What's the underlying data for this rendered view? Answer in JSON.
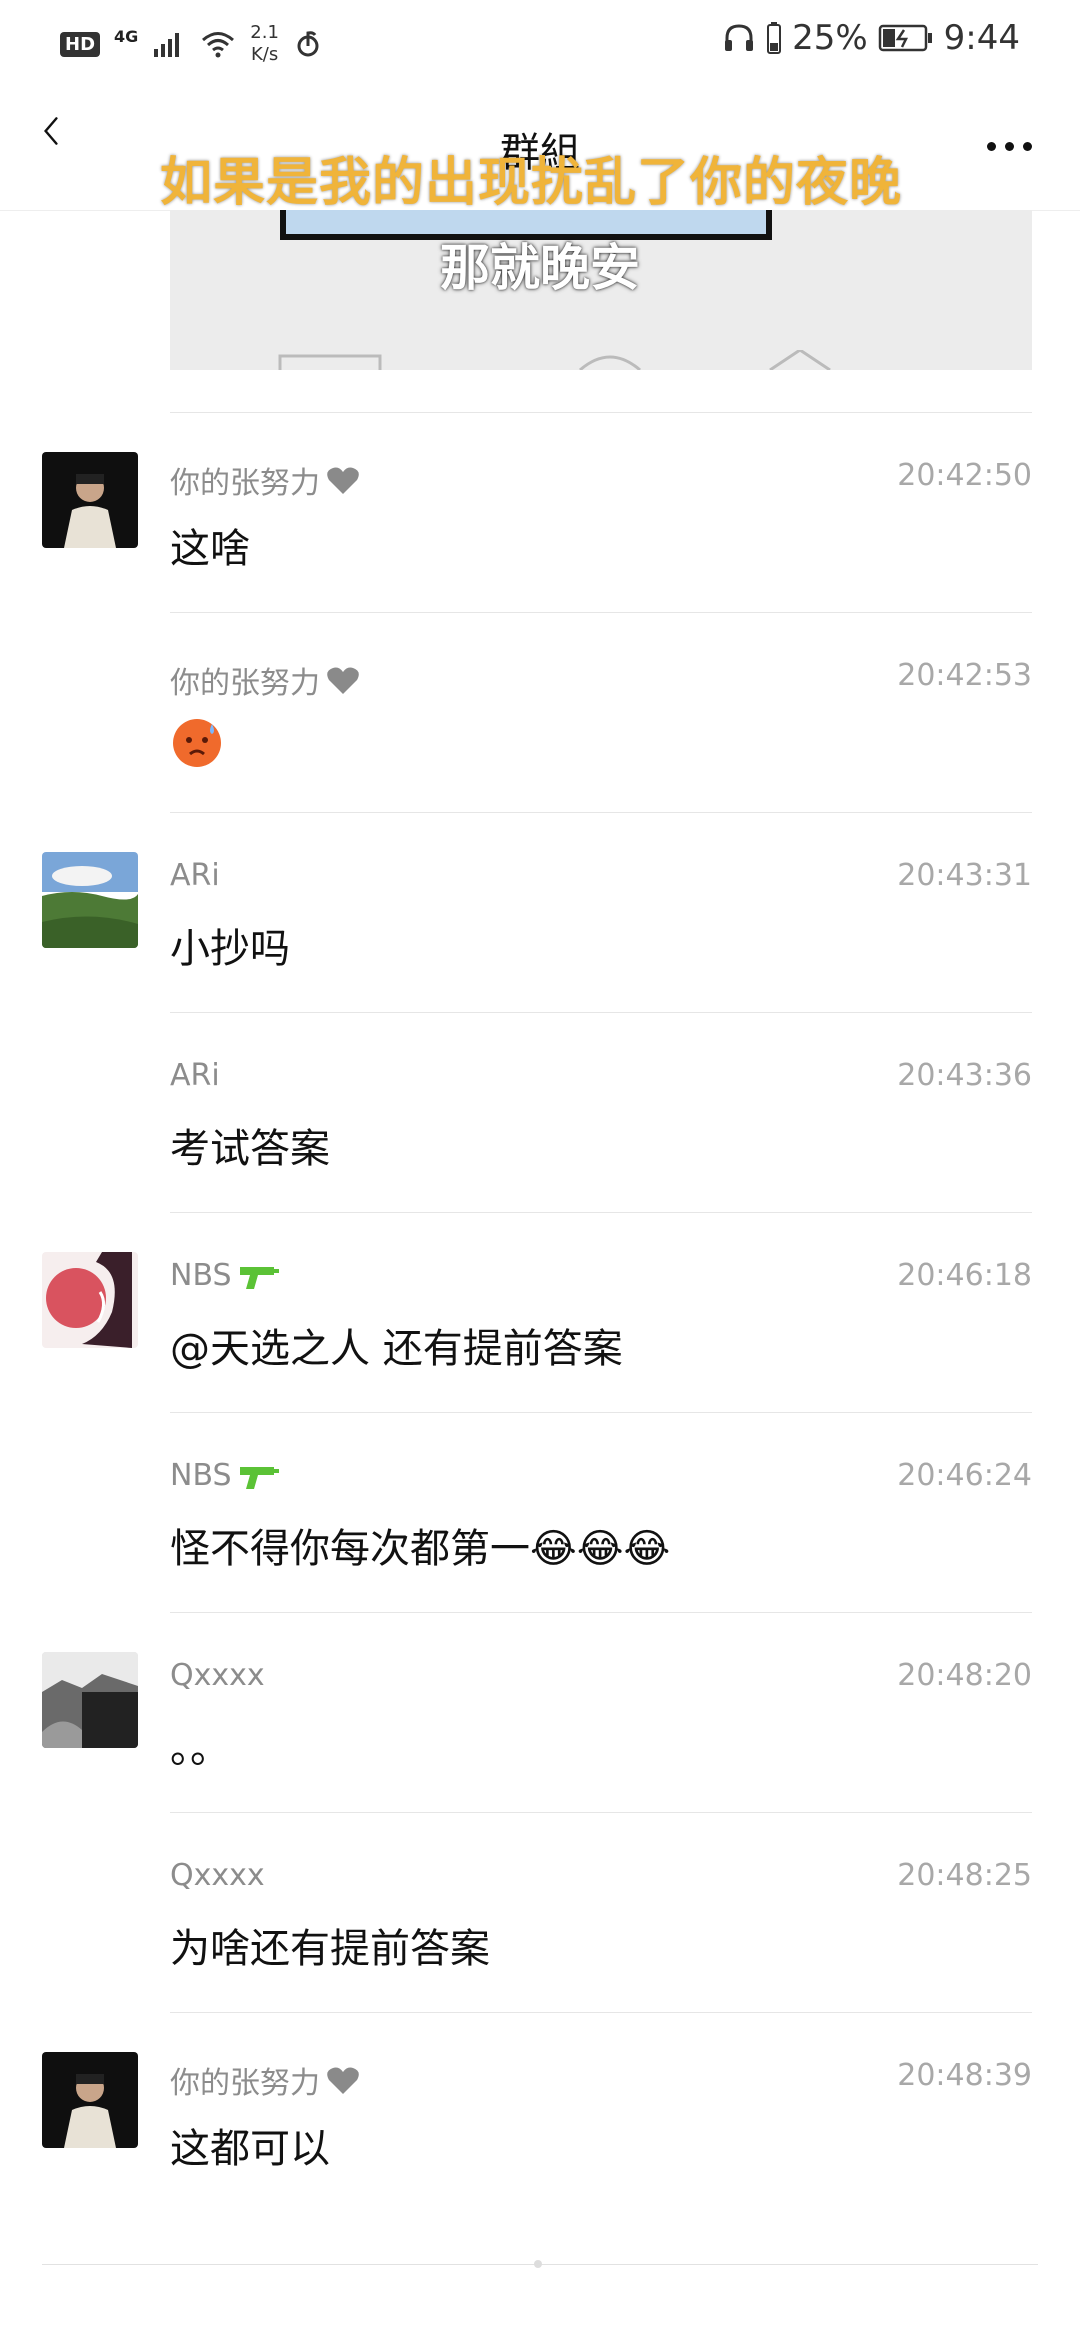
{
  "status_bar": {
    "hd": "HD",
    "network": "4G",
    "speed_top": "2.1",
    "speed_bottom": "K/s",
    "battery": "25%",
    "time": "9:44"
  },
  "nav": {
    "title": "群組"
  },
  "overlay_text": "如果是我的出现扰乱了你的夜晚",
  "subtitle_text": "那就晚安",
  "messages": [
    {
      "name": "你的张努力",
      "time": "20:42:50",
      "text": "这啥",
      "avatar": "portrait-dark"
    },
    {
      "name": "你的张努力",
      "time": "20:42:53",
      "text": "",
      "emoji": "sweat-angry-emoji"
    },
    {
      "name": "ARi",
      "time": "20:43:31",
      "text": "小抄吗",
      "avatar": "landscape"
    },
    {
      "name": "ARi",
      "time": "20:43:36",
      "text": "考试答案"
    },
    {
      "name": "NBS",
      "time": "20:46:18",
      "text": "@天选之人 还有提前答案",
      "avatar": "red-anime"
    },
    {
      "name": "NBS",
      "time": "20:46:24",
      "text": "怪不得你每次都第一😂😂😂"
    },
    {
      "name": "Qxxxx",
      "time": "20:48:20",
      "text": "。。",
      "avatar": "grayscale"
    },
    {
      "name": "Qxxxx",
      "time": "20:48:25",
      "text": "为啥还有提前答案"
    },
    {
      "name": "你的张努力",
      "time": "20:48:39",
      "text": "这都可以",
      "avatar": "portrait-dark"
    }
  ]
}
